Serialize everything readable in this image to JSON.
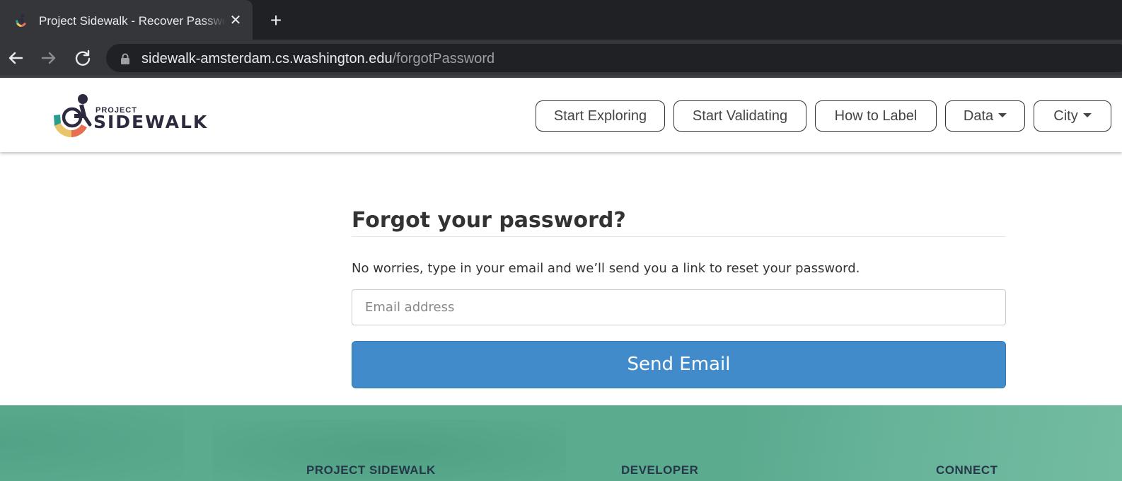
{
  "browser": {
    "tab_title": "Project Sidewalk - Recover Password",
    "tab_close": "✕",
    "new_tab": "+",
    "url_host": "sidewalk-amsterdam.cs.washington.edu",
    "url_path": "/forgotPassword"
  },
  "header": {
    "logo_top": "PROJECT",
    "logo_main": "SIDEWALK",
    "nav": {
      "start_exploring": "Start Exploring",
      "start_validating": "Start Validating",
      "how_to_label": "How to Label",
      "data": "Data",
      "city": "City"
    }
  },
  "main": {
    "title": "Forgot your password?",
    "description": "No worries, type in your email and we’ll send you a link to reset your password.",
    "email_placeholder": "Email address",
    "email_value": "",
    "send_label": "Send Email"
  },
  "footer": {
    "col1": "PROJECT SIDEWALK",
    "col2": "DEVELOPER",
    "col3": "CONNECT"
  },
  "colors": {
    "primary_button": "#428bca",
    "footer_bg": "#5bab8f",
    "chrome_dark": "#202124"
  },
  "icons": [
    "project-sidewalk-favicon",
    "back-arrow-icon",
    "forward-arrow-icon",
    "reload-icon",
    "lock-icon",
    "caret-down-icon"
  ]
}
